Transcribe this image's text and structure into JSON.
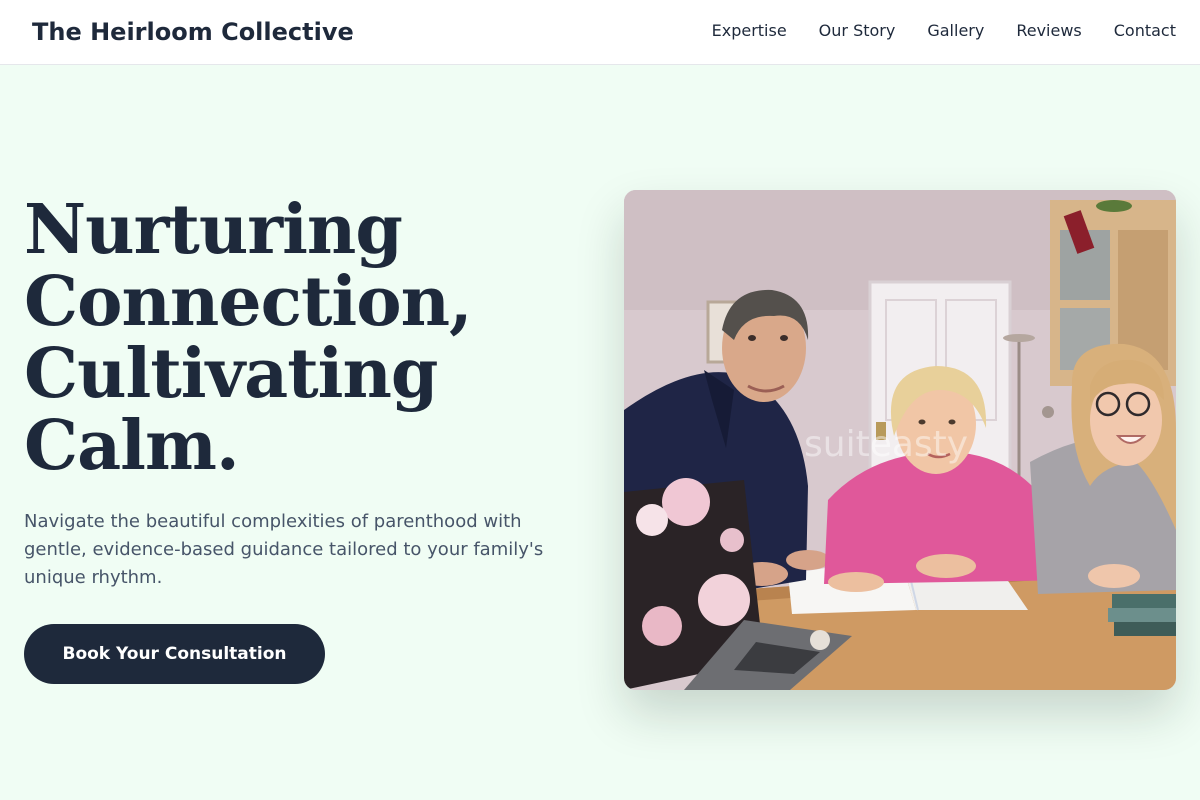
{
  "header": {
    "brand": "The Heirloom Collective",
    "nav": [
      {
        "label": "Expertise"
      },
      {
        "label": "Our Story"
      },
      {
        "label": "Gallery"
      },
      {
        "label": "Reviews"
      },
      {
        "label": "Contact"
      }
    ]
  },
  "hero": {
    "title_lines": [
      "Nurturing",
      "Connection,",
      "Cultivating",
      "Calm."
    ],
    "subtitle": "Navigate the beautiful complexities of parenthood with gentle, evidence-based guidance tailored to your family's unique rhythm.",
    "cta_label": "Book Your Consultation",
    "image_watermark": "suiteasty"
  },
  "colors": {
    "background": "#f0fdf4",
    "header_bg": "#ffffff",
    "primary": "#1e293b",
    "subtitle_text": "#475569"
  }
}
